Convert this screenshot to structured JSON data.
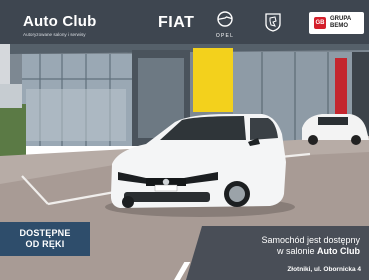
{
  "header": {
    "brand": "Auto Club",
    "tagline": "Autoryzowane salony i serwisy",
    "logos": [
      {
        "name": "fiat-logo",
        "text": "FIAT"
      },
      {
        "name": "opel-logo",
        "text": "OPEL"
      },
      {
        "name": "peugeot-logo",
        "text": ""
      }
    ],
    "group": {
      "badge": "GB",
      "line1": "GRUPA",
      "line2": "BEMO"
    }
  },
  "badge": {
    "line1": "DOSTĘPNE",
    "line2": "OD RĘKI"
  },
  "info": {
    "line1": "Samochód jest dostępny",
    "line2_prefix": "w salonie ",
    "line2_name": "Auto Club",
    "address": "Złotniki, ul. Obornicka 4"
  },
  "colors": {
    "header_bg": "#3e4650",
    "badge_bg": "#2e4d6b",
    "panel_bg": "#3e4650",
    "accent_red": "#d41f2b",
    "opel_yellow": "#f3d11c"
  }
}
